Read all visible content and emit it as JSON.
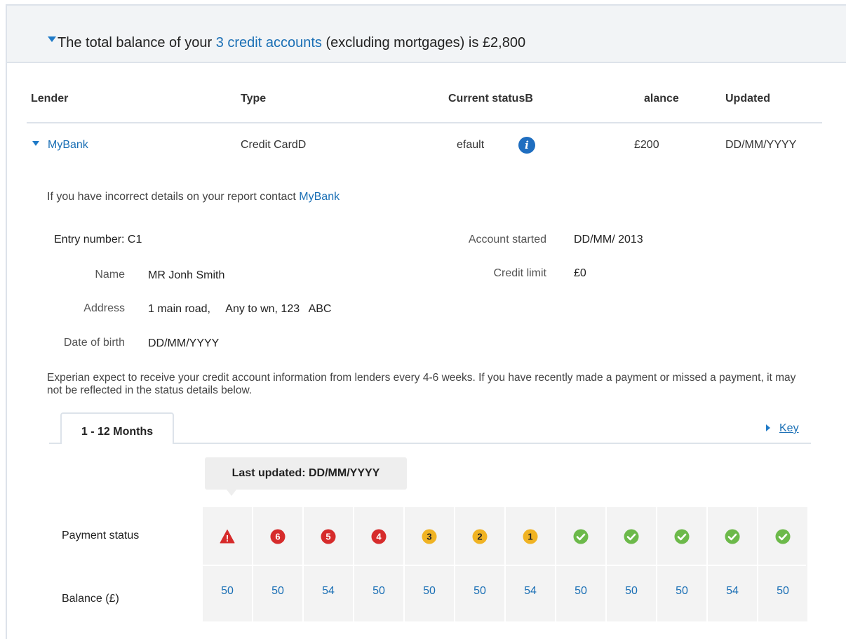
{
  "summary": {
    "prefix": "The total balance of your ",
    "link": "3 credit accounts",
    "suffix": " (excluding mortgages) is £2,800"
  },
  "table": {
    "headers": {
      "lender": "Lender",
      "type": "Type",
      "status": "Current statusB",
      "balance": "alance",
      "updated": "Updated"
    },
    "row": {
      "lender": "MyBank",
      "type": "Credit CardD",
      "status": "efault",
      "balance": "£200",
      "updated": "DD/MM/YYYY"
    }
  },
  "details": {
    "contact_text": "If you have incorrect details on your report contact ",
    "contact_link": "MyBank",
    "entry_number": "Entry number: C1",
    "name_label": "Name",
    "name_value": "MR Jonh Smith",
    "address_label": "Address",
    "address_value": "1 main road,     Any to wn, 123   ABC",
    "dob_label": "Date of birth",
    "dob_value": "DD/MM/YYYY",
    "started_label": "Account started",
    "started_value": "DD/MM/ 2013",
    "limit_label": "Credit limit",
    "limit_value": "£0"
  },
  "note": "Experian expect to receive your credit account information from lenders every 4-6 weeks. If you have recently made a payment or missed a payment, it may not be reflected in the status details below.",
  "tabs": {
    "active": "1 - 12 Months",
    "key_label": "Key"
  },
  "history": {
    "last_updated": "Last updated: DD/MM/YYYY",
    "status_label": "Payment status",
    "balance_label": "Balance (£)",
    "months": [
      {
        "status": "warning",
        "mark": "!",
        "balance": "50"
      },
      {
        "status": "late",
        "mark": "6",
        "balance": "50"
      },
      {
        "status": "late",
        "mark": "5",
        "balance": "54"
      },
      {
        "status": "late",
        "mark": "4",
        "balance": "50"
      },
      {
        "status": "arrears",
        "mark": "3",
        "balance": "50"
      },
      {
        "status": "arrears",
        "mark": "2",
        "balance": "50"
      },
      {
        "status": "arrears",
        "mark": "1",
        "balance": "54"
      },
      {
        "status": "ok",
        "mark": "",
        "balance": "50"
      },
      {
        "status": "ok",
        "mark": "",
        "balance": "50"
      },
      {
        "status": "ok",
        "mark": "",
        "balance": "50"
      },
      {
        "status": "ok",
        "mark": "",
        "balance": "54"
      },
      {
        "status": "ok",
        "mark": "",
        "balance": "50"
      }
    ]
  },
  "colors": {
    "accent": "#1a6fb5",
    "late": "#d62b2b",
    "arrears": "#f0b323",
    "ok": "#6cb94a"
  }
}
